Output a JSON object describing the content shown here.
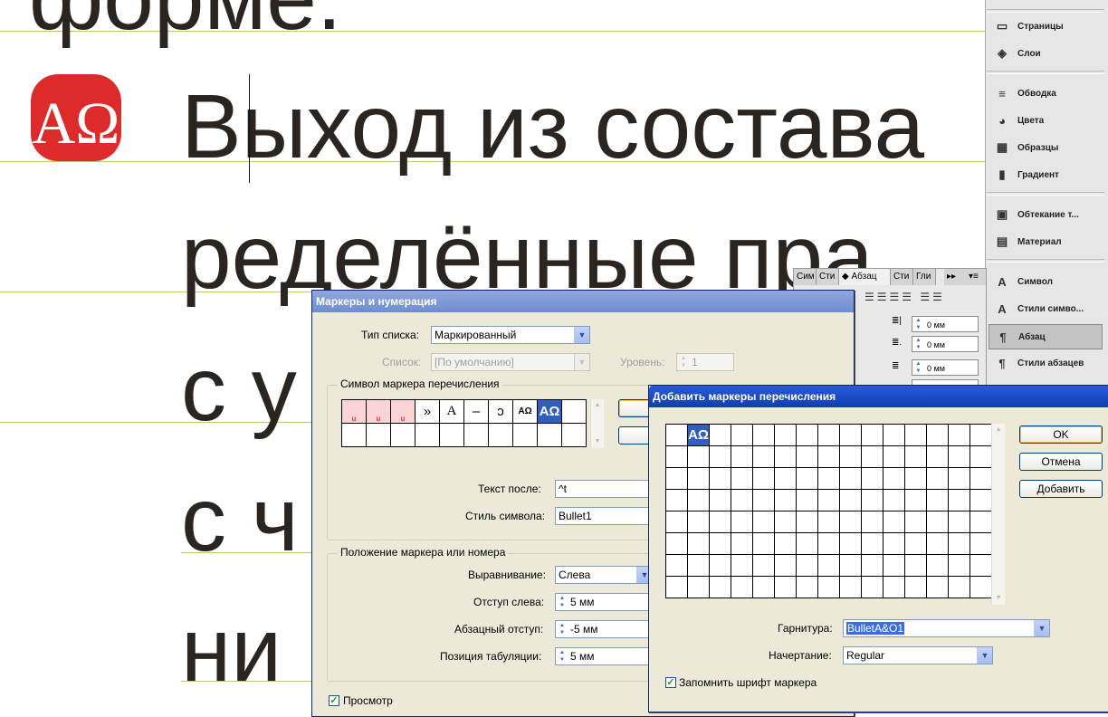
{
  "document": {
    "lines": [
      "форме.",
      "Выход из состава",
      "ределённые пра",
      "с у",
      "с ч",
      "ни"
    ]
  },
  "colors": {
    "logo_red": "#dd2a2a",
    "guide_green": "#b6c87a",
    "text_dark": "#2a2520",
    "dialog_bg": "#ece9d8",
    "title_blue": "#2a5ad8",
    "selection_blue": "#2f5fbf"
  },
  "logo": {
    "icon": "alpha-omega-logo-icon",
    "text": "АΩ"
  },
  "dock": {
    "items": [
      {
        "icon": "pages-icon",
        "label": "Страницы"
      },
      {
        "icon": "layers-icon",
        "label": "Слои"
      },
      {
        "icon": "stroke-icon",
        "label": "Обводка"
      },
      {
        "icon": "color-icon",
        "label": "Цвета"
      },
      {
        "icon": "swatches-icon",
        "label": "Образцы"
      },
      {
        "icon": "gradient-icon",
        "label": "Градиент"
      },
      {
        "icon": "text-wrap-icon",
        "label": "Обтекание т..."
      },
      {
        "icon": "material-icon",
        "label": "Материал"
      },
      {
        "icon": "character-icon",
        "label": "Символ"
      },
      {
        "icon": "character-styles-icon",
        "label": "Стили симво..."
      },
      {
        "icon": "paragraph-icon",
        "label": "Абзац"
      },
      {
        "icon": "paragraph-styles-icon",
        "label": "Стили абзацев"
      }
    ]
  },
  "paragraph_panel": {
    "tabs": [
      "Сим",
      "Сти",
      "Абзац",
      "Сти",
      "Гли"
    ],
    "more": "▸▸",
    "menu": "▾≡",
    "fields": [
      "0 мм",
      "0 мм",
      "0 мм",
      "0"
    ]
  },
  "bullets_dialog": {
    "title": "Маркеры и нумерация",
    "list_type_label": "Тип списка:",
    "list_type_value": "Маркированный",
    "list_label": "Список:",
    "list_value": "[По умолчанию]",
    "level_label": "Уровень:",
    "level_value": "1",
    "bullet_group_title": "Символ маркера перечисления",
    "glyphs": [
      "u",
      "u",
      "u",
      "»",
      "A",
      "–",
      "ɔ",
      "АΩ",
      "АΩ"
    ],
    "text_after_label": "Текст после:",
    "text_after_value": "^t",
    "char_style_label": "Стиль символа:",
    "char_style_value": "Bullet1",
    "position_group_title": "Положение маркера или номера",
    "alignment_label": "Выравнивание:",
    "alignment_value": "Слева",
    "left_indent_label": "Отступ слева:",
    "left_indent_value": "5 мм",
    "first_indent_label": "Абзацный отступ:",
    "first_indent_value": "-5 мм",
    "tab_pos_label": "Позиция табуляции:",
    "tab_pos_value": "5 мм",
    "preview_label": "Просмотр"
  },
  "add_bullets_dialog": {
    "title": "Добавить маркеры перечисления",
    "ok_label": "OK",
    "cancel_label": "Отмена",
    "add_label": "Добавить",
    "glyph": "АΩ",
    "font_label": "Гарнитура:",
    "font_value": "BulletA&O1",
    "style_label": "Начертание:",
    "style_value": "Regular",
    "remember_label": "Запомнить шрифт маркера"
  }
}
